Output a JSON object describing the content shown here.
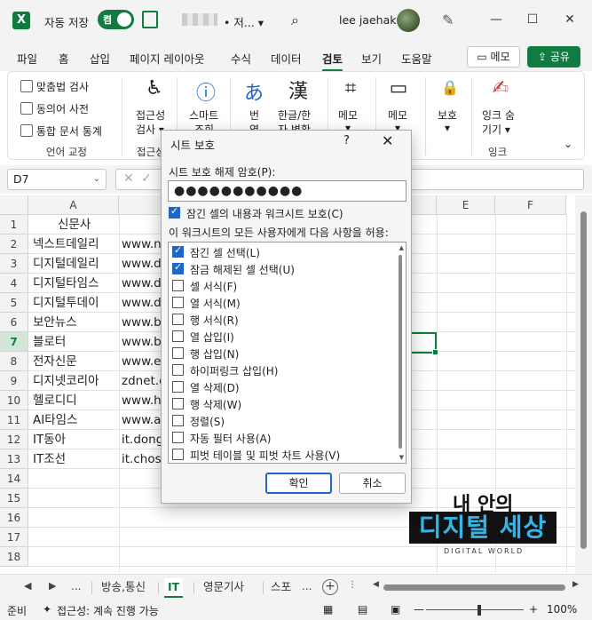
{
  "titlebar": {
    "app_logo": "X",
    "autosave_label": "자동 저장",
    "autosave_state": "켬",
    "filename": "• 저... ▾",
    "username": "lee jaehak"
  },
  "window_controls": [
    "—",
    "☐",
    "✕"
  ],
  "tabs": [
    "파일",
    "홈",
    "삽입",
    "페이지 레이아웃",
    "수식",
    "데이터",
    "검토",
    "보기",
    "도움말"
  ],
  "active_tab": "검토",
  "memo_button": "메모",
  "share_button": "공유",
  "ribbon": {
    "spelling": "맞춤법 검사",
    "thesaurus": "동의어 사전",
    "workbook_stats": "통합 문서 통계",
    "proofing_group": "언어 교정",
    "accessibility": "접근성",
    "accessibility2": "검사 ▾",
    "accessibility_group": "접근성",
    "smart_lookup": "스마트",
    "smart_lookup2": "조회",
    "translate": "번",
    "translate2": "역",
    "hanja": "한글/한",
    "hanja2": "자 변환",
    "memo1": "메모",
    "memo1b": "▾",
    "memo2": "메모",
    "memo2b": "▾",
    "protect": "보호",
    "protect2": "▾",
    "ink": "잉크 숨",
    "ink2": "기기 ▾",
    "ink_group": "잉크"
  },
  "formula_bar": {
    "namebox": "D7",
    "cancel": "✕",
    "confirm": "✓"
  },
  "columns": [
    "A",
    "E",
    "F"
  ],
  "rows": [
    "1",
    "2",
    "3",
    "4",
    "5",
    "6",
    "7",
    "8",
    "9",
    "10",
    "11",
    "12",
    "13",
    "14",
    "15",
    "16",
    "17",
    "18"
  ],
  "selected_row": "7",
  "cells_a": [
    "신문사",
    "넥스트데일리",
    "디지털데일리",
    "디지털타임스",
    "디지털투데이",
    "보안뉴스",
    "블로터",
    "전자신문",
    "디지넷코리아",
    "헬로디디",
    "AI타임스",
    "IT동아",
    "IT조선"
  ],
  "cells_b": [
    "",
    "www.n",
    "www.d",
    "www.d",
    "www.d",
    "www.b",
    "www.b",
    "www.e",
    "zdnet.c",
    "www.h",
    "www.a",
    "it.dong",
    "it.chos"
  ],
  "sheet_tabs": {
    "nav_prev": "◀",
    "nav_next": "▶",
    "more": "...",
    "tabs": [
      "방송,통신",
      "IT",
      "영문기사",
      "스포"
    ],
    "active": "IT",
    "more_right": "..."
  },
  "statusbar": {
    "ready": "준비",
    "accessibility": "접근성: 계속 진행 가능",
    "zoom": "100%",
    "zoom_minus": "—",
    "zoom_plus": "+"
  },
  "dialog": {
    "title": "시트 보호",
    "help": "?",
    "close": "✕",
    "password_label": "시트 보호 해제 암호(P):",
    "password_value": "●●●●●●●●●●●",
    "protect_label": "잠긴 셀의 내용과 워크시트 보호(C)",
    "protect_checked": true,
    "allow_label": "이 워크시트의 모든 사용자에게 다음 사항을 허용:",
    "permissions": [
      {
        "label": "잠긴 셀 선택(L)",
        "checked": true
      },
      {
        "label": "잠금 해제된 셀 선택(U)",
        "checked": true
      },
      {
        "label": "셀 서식(F)",
        "checked": false
      },
      {
        "label": "열 서식(M)",
        "checked": false
      },
      {
        "label": "행 서식(R)",
        "checked": false
      },
      {
        "label": "열 삽입(I)",
        "checked": false
      },
      {
        "label": "행 삽입(N)",
        "checked": false
      },
      {
        "label": "하이퍼링크 삽입(H)",
        "checked": false
      },
      {
        "label": "열 삭제(D)",
        "checked": false
      },
      {
        "label": "행 삭제(W)",
        "checked": false
      },
      {
        "label": "정렬(S)",
        "checked": false
      },
      {
        "label": "자동 필터 사용(A)",
        "checked": false
      },
      {
        "label": "피벗 테이블 및 피벗 차트 사용(V)",
        "checked": false
      }
    ],
    "ok": "확인",
    "cancel": "취소"
  },
  "watermark": {
    "top": "내 안의",
    "main": "디지털 세상",
    "sub": "DIGITAL WORLD"
  },
  "colors": {
    "excel_green": "#107c41",
    "checkbox_blue": "#1e66c8",
    "watermark_blue": "#37b3e6"
  }
}
